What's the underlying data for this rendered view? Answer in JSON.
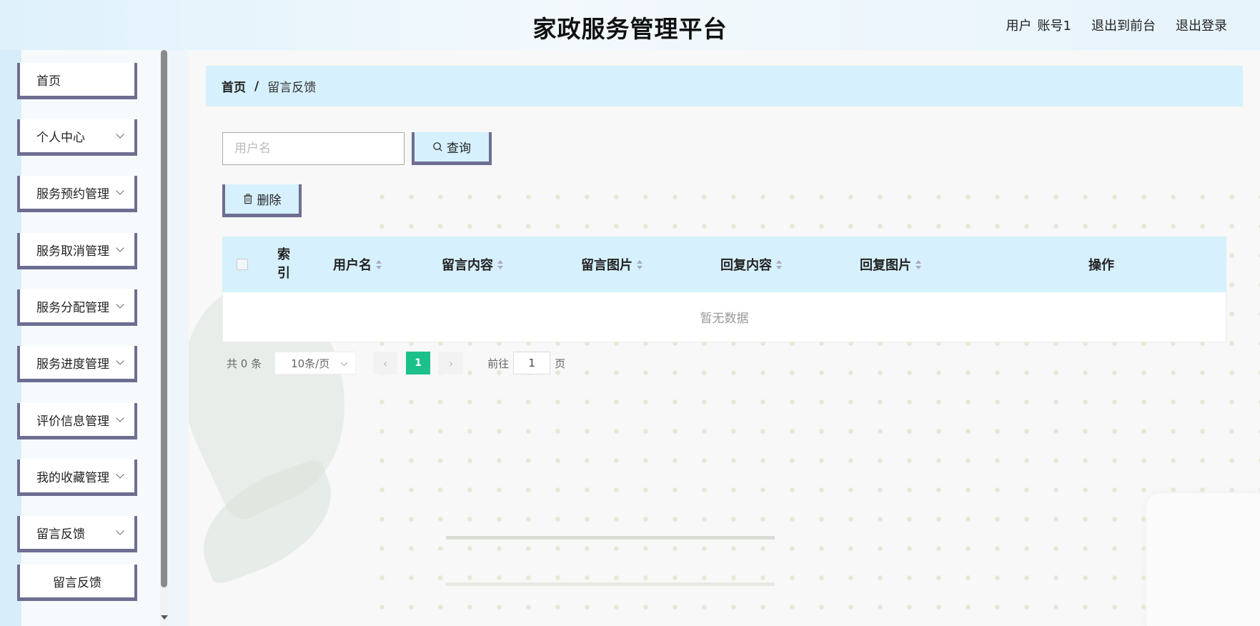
{
  "header": {
    "title": "家政服务管理平台",
    "user_label": "用户",
    "user_name": "账号1",
    "to_frontend": "退出到前台",
    "logout": "退出登录"
  },
  "sidebar": {
    "items": [
      {
        "label": "首页"
      },
      {
        "label": "个人中心"
      },
      {
        "label": "服务预约管理"
      },
      {
        "label": "服务取消管理"
      },
      {
        "label": "服务分配管理"
      },
      {
        "label": "服务进度管理"
      },
      {
        "label": "评价信息管理"
      },
      {
        "label": "我的收藏管理"
      },
      {
        "label": "留言反馈"
      }
    ],
    "sub_item": "留言反馈"
  },
  "breadcrumb": {
    "home": "首页",
    "separator": "/",
    "current": "留言反馈"
  },
  "search": {
    "placeholder": "用户名",
    "value": "",
    "query_label": "查询"
  },
  "toolbar": {
    "delete_label": "删除"
  },
  "table": {
    "columns": [
      "索引",
      "用户名",
      "留言内容",
      "留言图片",
      "回复内容",
      "回复图片",
      "操作"
    ],
    "empty_text": "暂无数据"
  },
  "pagination": {
    "total_text": "共 0 条",
    "page_size": "10条/页",
    "current_page": "1",
    "goto_label": "前往",
    "goto_value": "1",
    "page_label": "页"
  },
  "colors": {
    "accent": "#1cc08b",
    "border": "#6e6e92",
    "header_bg": "#d6f0fd"
  }
}
